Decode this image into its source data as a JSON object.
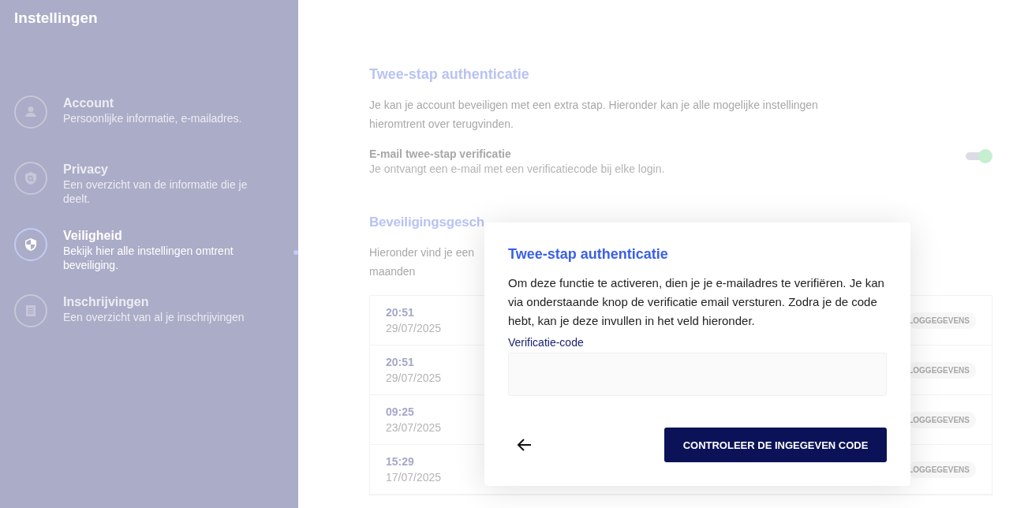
{
  "sidebar": {
    "title": "Instellingen",
    "items": [
      {
        "kind": "person",
        "label": "Account",
        "description": "Persoonlijke informatie, e-mailadres.",
        "selected": false
      },
      {
        "kind": "privacy",
        "label": "Privacy",
        "description": "Een overzicht van de informatie die je deelt.",
        "selected": false
      },
      {
        "kind": "shield",
        "label": "Veiligheid",
        "description": "Bekijk hier alle instellingen omtrent beveiliging.",
        "selected": true
      },
      {
        "kind": "list",
        "label": "Inschrijvingen",
        "description": "Een overzicht van al je inschrijvingen",
        "selected": false
      }
    ]
  },
  "two_step": {
    "heading": "Twee-stap authenticatie",
    "description": "Je kan je account beveiligen met een extra stap. Hieronder kan je alle mogelijke instellingen hieromtrent over terugvinden.",
    "setting": {
      "label": "E-mail twee-stap verificatie",
      "description": "Je ontvangt een e-mail met een verificatiecode bij elke login.",
      "on": true
    }
  },
  "history": {
    "heading": "Beveiligingsgesch",
    "intro_lines": [
      "Hieronder vind je een",
      "maanden"
    ],
    "rows": [
      {
        "time": "20:51",
        "date": "29/07/2025",
        "badge": "LOGGEGEVENS"
      },
      {
        "time": "20:51",
        "date": "29/07/2025",
        "badge": "LOGGEGEVENS"
      },
      {
        "time": "09:25",
        "date": "23/07/2025",
        "badge": "LOGGEGEVENS"
      },
      {
        "time": "15:29",
        "date": "17/07/2025",
        "badge": "LOGGEGEVENS"
      }
    ]
  },
  "modal": {
    "title": "Twee-stap authenticatie",
    "body": "Om deze functie te activeren, dien je je e-mailadres te verifiëren. Je kan via onderstaande knop de verificatie email versturen. Zodra je de code hebt, kan je deze invullen in het veld hieronder.",
    "field_label": "Verificatie-code",
    "submit": "CONTROLEER DE INGEGEVEN CODE"
  }
}
